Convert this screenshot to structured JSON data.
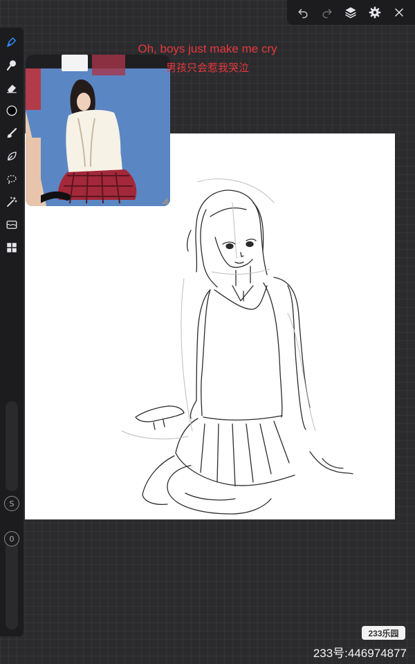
{
  "captions": {
    "english": "Oh, boys just make me cry",
    "chinese": "男孩只会惹我哭泣",
    "color": "#e8383d"
  },
  "top_toolbar": {
    "icons": [
      "undo-icon",
      "redo-icon",
      "layers-icon",
      "settings-icon",
      "close-icon"
    ]
  },
  "left_toolbar": {
    "tools": [
      "pen-icon",
      "smudge-icon",
      "eraser-icon",
      "color-icon",
      "brush-icon",
      "leaf-icon",
      "lasso-icon",
      "magic-wand-icon",
      "adjust-icon",
      "grid-icon"
    ],
    "size_slider_label": "S",
    "opacity_slider_label": "0"
  },
  "reference_window": {
    "icon": "reference-image"
  },
  "watermark": {
    "logo_text": "233乐园",
    "id_text": "233号:446974877"
  }
}
